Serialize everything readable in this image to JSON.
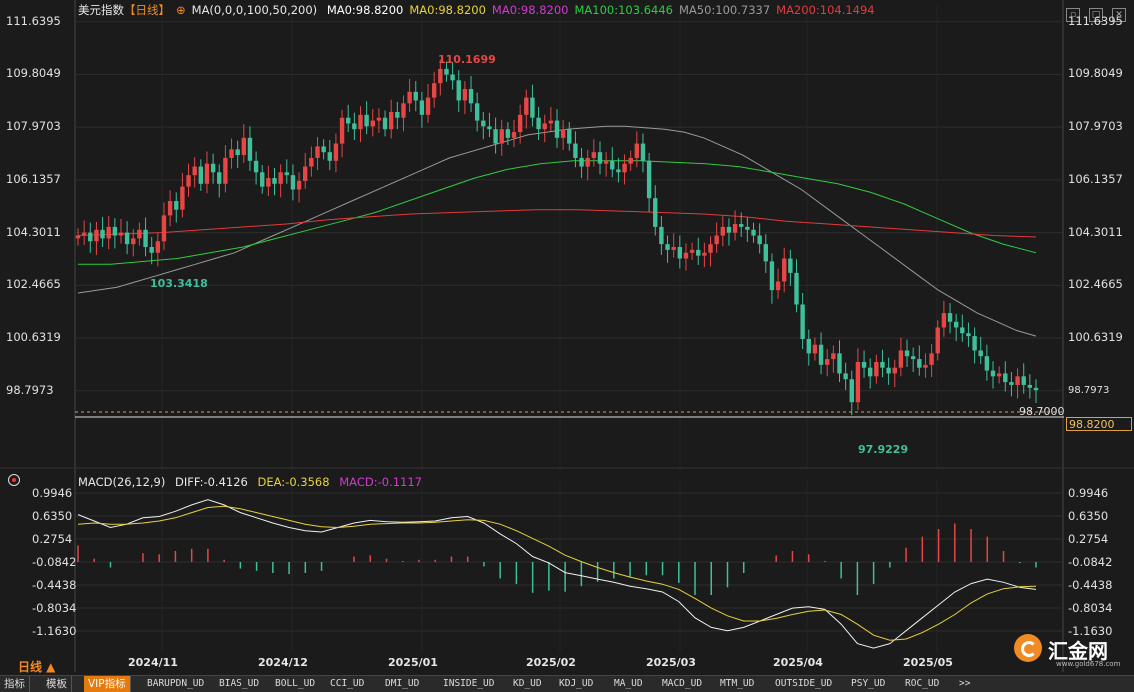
{
  "header": {
    "title": "美元指数",
    "period_tag": "【日线】",
    "ma_params": "MA(0,0,0,100,50,200)",
    "ma_items": [
      {
        "label": "MA0:98.8200",
        "color": "#ffffff"
      },
      {
        "label": "MA0:98.8200",
        "color": "#e8d23a"
      },
      {
        "label": "MA0:98.8200",
        "color": "#d23ad2"
      },
      {
        "label": "MA100:103.6446",
        "color": "#2ecc40"
      },
      {
        "label": "MA50:100.7337",
        "color": "#9a9a9a"
      },
      {
        "label": "MA200:104.1494",
        "color": "#e23b3b"
      }
    ]
  },
  "macd_header": {
    "title": "MACD(26,12,9)",
    "diff": "DIFF:-0.4126",
    "dea": "DEA:-0.3568",
    "macd": "MACD:-0.1117"
  },
  "main_axis": {
    "ticks": [
      "111.6395",
      "109.8049",
      "107.9703",
      "106.1357",
      "104.3011",
      "102.4665",
      "100.6319",
      "98.7973"
    ],
    "right_last": "98.7973",
    "current_price": "98.8200",
    "inline_price": "98.7000"
  },
  "macd_axis": {
    "ticks": [
      "0.9946",
      "0.6350",
      "0.2754",
      "-0.0842",
      "-0.4438",
      "-0.8034",
      "-1.1630"
    ]
  },
  "x_axis": {
    "labels": [
      "2024/11",
      "2024/12",
      "2025/01",
      "2025/02",
      "2025/03",
      "2025/04",
      "2025/05"
    ]
  },
  "annotations": {
    "high": "110.1699",
    "low1": "103.3418",
    "low2": "97.9229"
  },
  "period_button": "日线 ▲",
  "logo": {
    "name": "汇金网",
    "url": "www.gold678.com"
  },
  "bottom_bar": {
    "tabs": [
      "指标",
      "模板",
      "VIP指标"
    ],
    "indicators": [
      "BARUPDN_UD",
      "BIAS_UD",
      "BOLL_UD",
      "CCI_UD",
      "DMI_UD",
      "INSIDE_UD",
      "KD_UD",
      "KDJ_UD",
      "MA_UD",
      "MACD_UD",
      "MTM_UD",
      "OUTSIDE_UD",
      "PSY_UD",
      "ROC_UD",
      ">>"
    ]
  },
  "colors": {
    "up": "#e84545",
    "down": "#3fbf9a",
    "bg": "#1b1b1b",
    "accent": "#e57a0e"
  },
  "chart_data": {
    "type": "candlestick",
    "ylim": [
      97.5,
      112.0
    ],
    "closes": [
      104.2,
      104.3,
      104.0,
      104.4,
      104.1,
      104.5,
      104.2,
      104.3,
      103.9,
      104.1,
      104.4,
      103.8,
      103.6,
      104.0,
      104.9,
      105.4,
      105.1,
      105.9,
      106.3,
      106.6,
      106.0,
      106.7,
      106.4,
      106.0,
      106.9,
      107.2,
      107.0,
      107.6,
      106.8,
      106.4,
      105.9,
      106.2,
      106.0,
      106.4,
      106.3,
      105.8,
      106.1,
      106.6,
      106.9,
      107.3,
      107.1,
      106.8,
      107.4,
      108.3,
      108.1,
      107.9,
      108.4,
      108.0,
      108.2,
      108.3,
      107.9,
      108.5,
      108.3,
      108.8,
      109.2,
      108.9,
      108.4,
      109.0,
      109.5,
      110.0,
      109.8,
      109.6,
      108.9,
      109.3,
      108.8,
      108.2,
      108.0,
      107.9,
      107.4,
      107.9,
      107.6,
      107.8,
      108.4,
      109.0,
      108.3,
      107.9,
      108.1,
      108.2,
      107.6,
      107.9,
      107.4,
      106.9,
      106.6,
      106.9,
      107.1,
      106.7,
      106.8,
      106.5,
      106.4,
      106.7,
      106.9,
      107.4,
      106.8,
      105.5,
      104.5,
      103.9,
      103.7,
      103.8,
      103.4,
      103.6,
      103.7,
      103.5,
      103.6,
      103.9,
      104.2,
      104.5,
      104.3,
      104.6,
      104.5,
      104.4,
      104.2,
      103.9,
      103.3,
      102.3,
      102.6,
      103.4,
      102.9,
      101.8,
      100.6,
      100.1,
      100.4,
      99.7,
      99.9,
      100.1,
      99.4,
      99.2,
      98.4,
      99.8,
      99.6,
      99.3,
      99.8,
      99.6,
      99.4,
      99.6,
      100.2,
      100.0,
      99.9,
      99.6,
      99.7,
      100.1,
      101.0,
      101.5,
      101.2,
      101.0,
      100.8,
      100.7,
      100.2,
      100.0,
      99.5,
      99.3,
      99.4,
      99.1,
      99.0,
      99.3,
      99.0,
      98.9,
      98.82
    ],
    "ma50": [
      102.2,
      102.3,
      102.4,
      102.6,
      102.8,
      103.0,
      103.2,
      103.4,
      103.6,
      103.9,
      104.2,
      104.5,
      104.8,
      105.1,
      105.4,
      105.7,
      106.0,
      106.3,
      106.6,
      106.9,
      107.1,
      107.3,
      107.5,
      107.7,
      107.8,
      107.9,
      107.95,
      108.0,
      108.0,
      107.95,
      107.9,
      107.8,
      107.6,
      107.3,
      107.0,
      106.6,
      106.2,
      105.8,
      105.3,
      104.8,
      104.3,
      103.8,
      103.3,
      102.8,
      102.3,
      101.9,
      101.5,
      101.2,
      100.9,
      100.7
    ],
    "ma100": [
      103.2,
      103.2,
      103.3,
      103.4,
      103.6,
      103.8,
      104.1,
      104.4,
      104.7,
      105.0,
      105.4,
      105.8,
      106.2,
      106.5,
      106.7,
      106.8,
      106.8,
      106.8,
      106.75,
      106.7,
      106.6,
      106.4,
      106.2,
      106.0,
      105.7,
      105.3,
      104.8,
      104.3,
      103.9,
      103.6
    ],
    "ma200": [
      104.2,
      104.25,
      104.3,
      104.4,
      104.5,
      104.6,
      104.75,
      104.85,
      104.95,
      105.0,
      105.05,
      105.1,
      105.1,
      105.05,
      105.0,
      104.95,
      104.85,
      104.7,
      104.6,
      104.5,
      104.4,
      104.3,
      104.2,
      104.15
    ],
    "macd": {
      "ylim": [
        -1.35,
        1.1
      ],
      "diff": [
        0.75,
        0.65,
        0.55,
        0.6,
        0.7,
        0.72,
        0.8,
        0.9,
        0.98,
        0.9,
        0.78,
        0.7,
        0.62,
        0.55,
        0.5,
        0.48,
        0.55,
        0.62,
        0.66,
        0.64,
        0.63,
        0.64,
        0.65,
        0.7,
        0.72,
        0.62,
        0.45,
        0.3,
        0.1,
        0.0,
        -0.15,
        -0.2,
        -0.25,
        -0.3,
        -0.36,
        -0.4,
        -0.45,
        -0.6,
        -0.85,
        -1.0,
        -1.05,
        -1.0,
        -0.9,
        -0.8,
        -0.7,
        -0.68,
        -0.72,
        -0.95,
        -1.25,
        -1.32,
        -1.25,
        -1.05,
        -0.85,
        -0.65,
        -0.45,
        -0.32,
        -0.25,
        -0.3,
        -0.38,
        -0.41
      ],
      "dea": [
        0.6,
        0.62,
        0.6,
        0.6,
        0.62,
        0.65,
        0.7,
        0.78,
        0.86,
        0.88,
        0.84,
        0.78,
        0.72,
        0.66,
        0.6,
        0.56,
        0.55,
        0.57,
        0.6,
        0.61,
        0.62,
        0.62,
        0.63,
        0.65,
        0.67,
        0.66,
        0.6,
        0.5,
        0.38,
        0.26,
        0.12,
        0.02,
        -0.07,
        -0.15,
        -0.22,
        -0.28,
        -0.33,
        -0.41,
        -0.55,
        -0.7,
        -0.82,
        -0.9,
        -0.9,
        -0.86,
        -0.8,
        -0.75,
        -0.73,
        -0.8,
        -0.95,
        -1.12,
        -1.2,
        -1.18,
        -1.08,
        -0.95,
        -0.8,
        -0.62,
        -0.48,
        -0.4,
        -0.37,
        -0.36
      ]
    }
  }
}
